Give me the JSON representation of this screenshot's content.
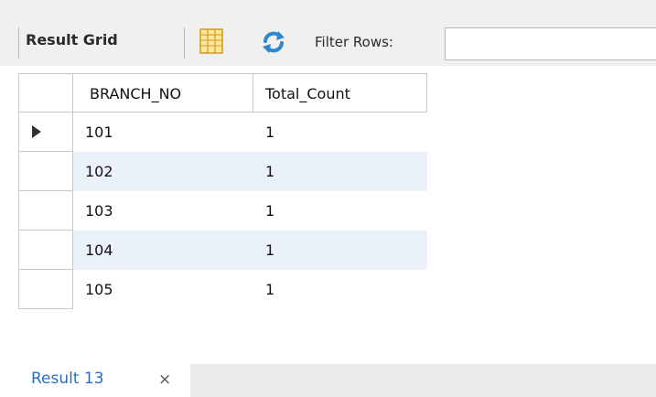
{
  "toolbar": {
    "result_grid_label": "Result Grid",
    "filter_label": "Filter Rows:",
    "filter_value": "",
    "icons": {
      "grid_view": "grid-view-icon",
      "refresh": "refresh-icon"
    }
  },
  "grid": {
    "columns": [
      "BRANCH_NO",
      "Total_Count"
    ],
    "rows": [
      {
        "branch_no": "101",
        "total_count": "1",
        "current": true
      },
      {
        "branch_no": "102",
        "total_count": "1",
        "current": false
      },
      {
        "branch_no": "103",
        "total_count": "1",
        "current": false
      },
      {
        "branch_no": "104",
        "total_count": "1",
        "current": false
      },
      {
        "branch_no": "105",
        "total_count": "1",
        "current": false
      }
    ]
  },
  "tabs": [
    {
      "label": "Result 13",
      "close": "×"
    }
  ],
  "colors": {
    "toolbar_bg": "#f0f0f0",
    "alt_row": "#eaf1fb",
    "tab_text": "#2a6ebb",
    "grid_line": "#c8c8c8"
  }
}
